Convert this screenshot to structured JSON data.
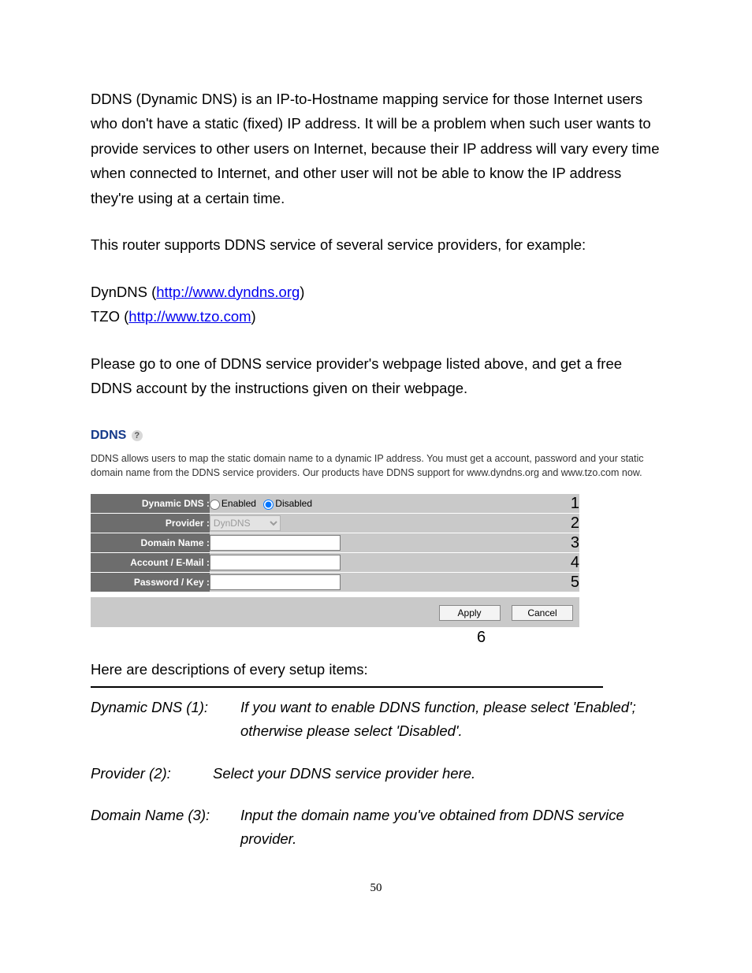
{
  "intro_para": "DDNS (Dynamic DNS) is an IP-to-Hostname mapping service for those Internet users who don't have a static (fixed) IP address. It will be a problem when such user wants to provide services to other users on Internet, because their IP address will vary every time when connected to Internet, and other user will not be able to know the IP address they're using at a certain time.",
  "support_para": "This router supports DDNS service of several service providers, for example:",
  "providers": {
    "p1_prefix": "DynDNS (",
    "p1_link": "http://www.dyndns.org",
    "p1_suffix": ")",
    "p2_prefix": "TZO (",
    "p2_link": "http://www.tzo.com",
    "p2_suffix": ")"
  },
  "instruct_para": "Please go to one of DDNS service provider's webpage listed above, and get a free DDNS account by the instructions given on their webpage.",
  "panel": {
    "title": "DDNS",
    "help": "?",
    "desc": "DDNS allows users to map the static domain name to a dynamic IP address. You must get a account, password and your static domain name from the DDNS service providers. Our products have DDNS support for www.dyndns.org and www.tzo.com now.",
    "rows": {
      "r1_label": "Dynamic DNS :",
      "r1_enabled": "Enabled",
      "r1_disabled": "Disabled",
      "r1_num": "1",
      "r2_label": "Provider :",
      "r2_option": "DynDNS",
      "r2_num": "2",
      "r3_label": "Domain Name :",
      "r3_num": "3",
      "r4_label": "Account / E-Mail :",
      "r4_num": "4",
      "r5_label": "Password / Key :",
      "r5_num": "5"
    },
    "buttons": {
      "apply": "Apply",
      "cancel": "Cancel"
    },
    "six": "6"
  },
  "desc_intro": "Here are descriptions of every setup items:",
  "descriptions": {
    "d1_label": "Dynamic DNS (1):",
    "d1_text": "If you want to enable DDNS function, please select 'Enabled'; otherwise please select 'Disabled'.",
    "d2_label": "Provider (2):",
    "d2_text": "Select your DDNS service provider here.",
    "d3_label": "Domain Name (3):",
    "d3_text": "Input the domain name you've obtained from DDNS service provider."
  },
  "page_number": "50"
}
